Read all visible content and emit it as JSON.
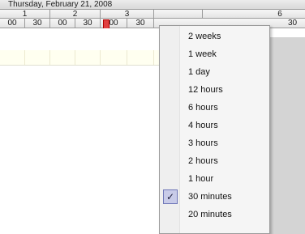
{
  "header": {
    "date_label": "Thursday, February 21, 2008",
    "hours": [
      "1",
      "2",
      "3",
      "",
      "6"
    ],
    "minutes": [
      "00",
      "30",
      "00",
      "30",
      "00",
      "30",
      "30"
    ]
  },
  "menu": {
    "items": [
      {
        "label": "2 weeks",
        "checked": false
      },
      {
        "label": "1 week",
        "checked": false
      },
      {
        "label": "1 day",
        "checked": false
      },
      {
        "label": "12 hours",
        "checked": false
      },
      {
        "label": "6 hours",
        "checked": false
      },
      {
        "label": "4 hours",
        "checked": false
      },
      {
        "label": "3 hours",
        "checked": false
      },
      {
        "label": "2 hours",
        "checked": false
      },
      {
        "label": "1 hour",
        "checked": false
      },
      {
        "label": "30 minutes",
        "checked": true
      },
      {
        "label": "20 minutes",
        "checked": false
      }
    ],
    "check_glyph": "✓"
  },
  "colors": {
    "now_marker": "#e04040",
    "working_hours": "#fffff0",
    "checked_item": "#c8cbe8"
  }
}
